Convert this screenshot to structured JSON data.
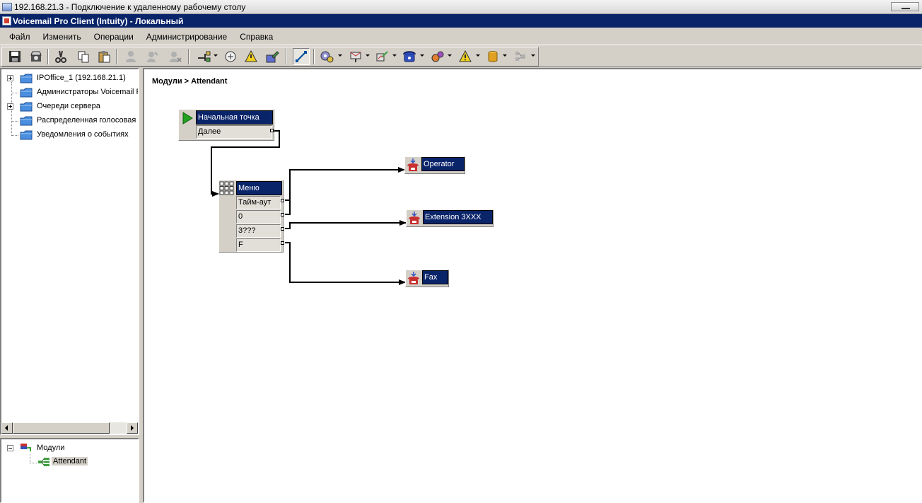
{
  "rdp": {
    "title": "192.168.21.3 - Подключение к удаленному рабочему столу"
  },
  "app": {
    "title": "Voicemail Pro Client (Intuity) - Локальный"
  },
  "menu": [
    "Файл",
    "Изменить",
    "Операции",
    "Администрирование",
    "Справка"
  ],
  "toolbar": {
    "buttons": [
      {
        "icon": "save-icon"
      },
      {
        "icon": "save-as-icon"
      },
      {
        "icon": "cut-icon"
      },
      {
        "icon": "copy-icon"
      },
      {
        "icon": "paste-icon"
      },
      {
        "icon": "user-add-icon"
      },
      {
        "icon": "user-edit-icon"
      },
      {
        "icon": "user-delete-icon"
      },
      {
        "icon": "module-add-icon"
      },
      {
        "icon": "variables-icon"
      },
      {
        "icon": "condition-icon"
      },
      {
        "icon": "edit-icon"
      },
      {
        "icon": "connection-tool-icon"
      },
      {
        "icon": "basic-actions-icon"
      },
      {
        "icon": "mailbox-actions-icon"
      },
      {
        "icon": "configuration-actions-icon"
      },
      {
        "icon": "telephony-actions-icon"
      },
      {
        "icon": "misc-actions-icon"
      },
      {
        "icon": "condition-actions-icon"
      },
      {
        "icon": "database-actions-icon"
      },
      {
        "icon": "queue-actions-icon"
      }
    ]
  },
  "tree": {
    "items": [
      {
        "label": "IPOffice_1 (192.168.21.1)",
        "icon": "folder-icon",
        "expandable": true
      },
      {
        "label": "Администраторы Voicemail P",
        "icon": "folder-icon",
        "expandable": false
      },
      {
        "label": "Очереди сервера",
        "icon": "folder-icon",
        "expandable": true
      },
      {
        "label": "Распределенная голосовая",
        "icon": "folder-icon",
        "expandable": false
      },
      {
        "label": "Уведомления о событиях",
        "icon": "folder-icon",
        "expandable": false
      }
    ]
  },
  "modules": {
    "root": "Модули",
    "children": [
      {
        "label": "Attendant",
        "selected": true
      }
    ]
  },
  "canvas": {
    "breadcrumb": "Модули > Attendant",
    "start_node": {
      "title": "Начальная точка",
      "rows": [
        "Далее"
      ]
    },
    "menu_node": {
      "title": "Меню",
      "rows": [
        "Тайм-аут",
        "0",
        "3???",
        "F"
      ]
    },
    "targets": [
      {
        "label": "Operator"
      },
      {
        "label": "Extension 3XXX"
      },
      {
        "label": "Fax"
      }
    ]
  },
  "colors": {
    "title_bar": "#0a246a",
    "node_title": "#0a246a",
    "face": "#d4d0c8",
    "start_arrow": "#22a020",
    "phone": "#c83030"
  }
}
